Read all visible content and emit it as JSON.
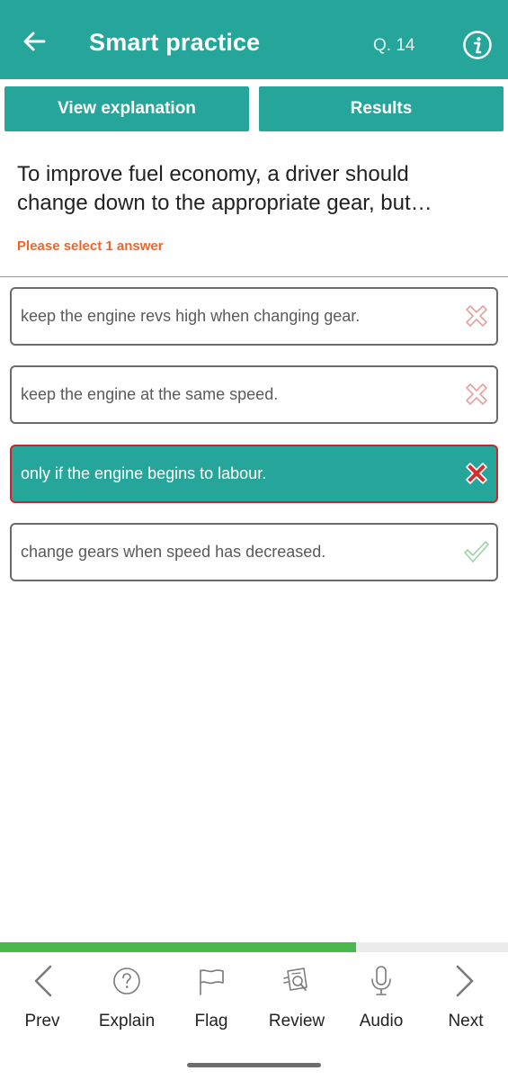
{
  "header": {
    "title": "Smart practice",
    "question_number": "Q. 14"
  },
  "tabs": {
    "view_explanation": "View explanation",
    "results": "Results"
  },
  "question": {
    "text": "To improve fuel economy, a driver should change down to the appropriate gear, but…",
    "instruction": "Please select 1 answer"
  },
  "answers": [
    {
      "text": "keep the engine revs high when changing gear.",
      "mark": "wrong-outline",
      "selected": false
    },
    {
      "text": "keep the engine at the same speed.",
      "mark": "wrong-outline",
      "selected": false
    },
    {
      "text": "only if the engine begins to labour.",
      "mark": "wrong-filled",
      "selected": true
    },
    {
      "text": "change gears when speed has decreased.",
      "mark": "correct-outline",
      "selected": false
    }
  ],
  "progress": {
    "fraction": 0.7
  },
  "bottom_nav": [
    {
      "label": "Prev",
      "icon": "chevron-left-icon"
    },
    {
      "label": "Explain",
      "icon": "question-circle-icon"
    },
    {
      "label": "Flag",
      "icon": "flag-icon"
    },
    {
      "label": "Review",
      "icon": "review-icon"
    },
    {
      "label": "Audio",
      "icon": "microphone-icon"
    },
    {
      "label": "Next",
      "icon": "chevron-right-icon"
    }
  ],
  "colors": {
    "primary": "#26a69a",
    "instruction": "#f0662a",
    "wrong": "#d32f2f",
    "correct": "#4bb84e"
  }
}
